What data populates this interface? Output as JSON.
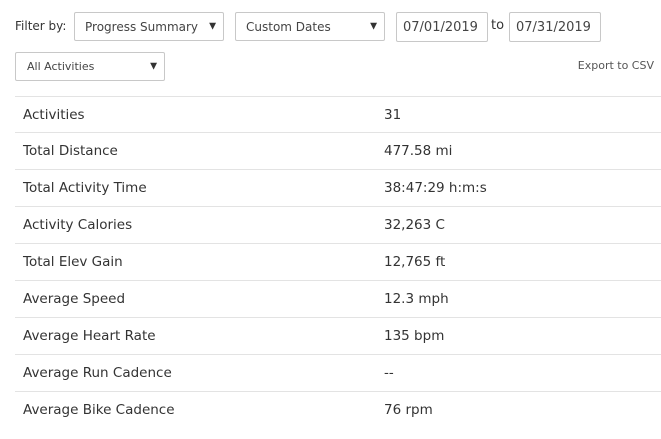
{
  "filter": {
    "label": "Filter by:",
    "report_select": "Progress Summary",
    "date_range_select": "Custom Dates",
    "date_from": "07/01/2019",
    "to_label": "to",
    "date_to": "07/31/2019",
    "activity_select": "All Activities",
    "caret_icon": "caret-down-icon"
  },
  "export_label": "Export to CSV",
  "stats": [
    {
      "label": "Activities",
      "value": "31"
    },
    {
      "label": "Total Distance",
      "value": "477.58 mi"
    },
    {
      "label": "Total Activity Time",
      "value": "38:47:29 h:m:s"
    },
    {
      "label": "Activity Calories",
      "value": "32,263 C"
    },
    {
      "label": "Total Elev Gain",
      "value": "12,765 ft"
    },
    {
      "label": "Average Speed",
      "value": "12.3 mph"
    },
    {
      "label": "Average Heart Rate",
      "value": "135 bpm"
    },
    {
      "label": "Average Run Cadence",
      "value": "--"
    },
    {
      "label": "Average Bike Cadence",
      "value": "76 rpm"
    }
  ]
}
